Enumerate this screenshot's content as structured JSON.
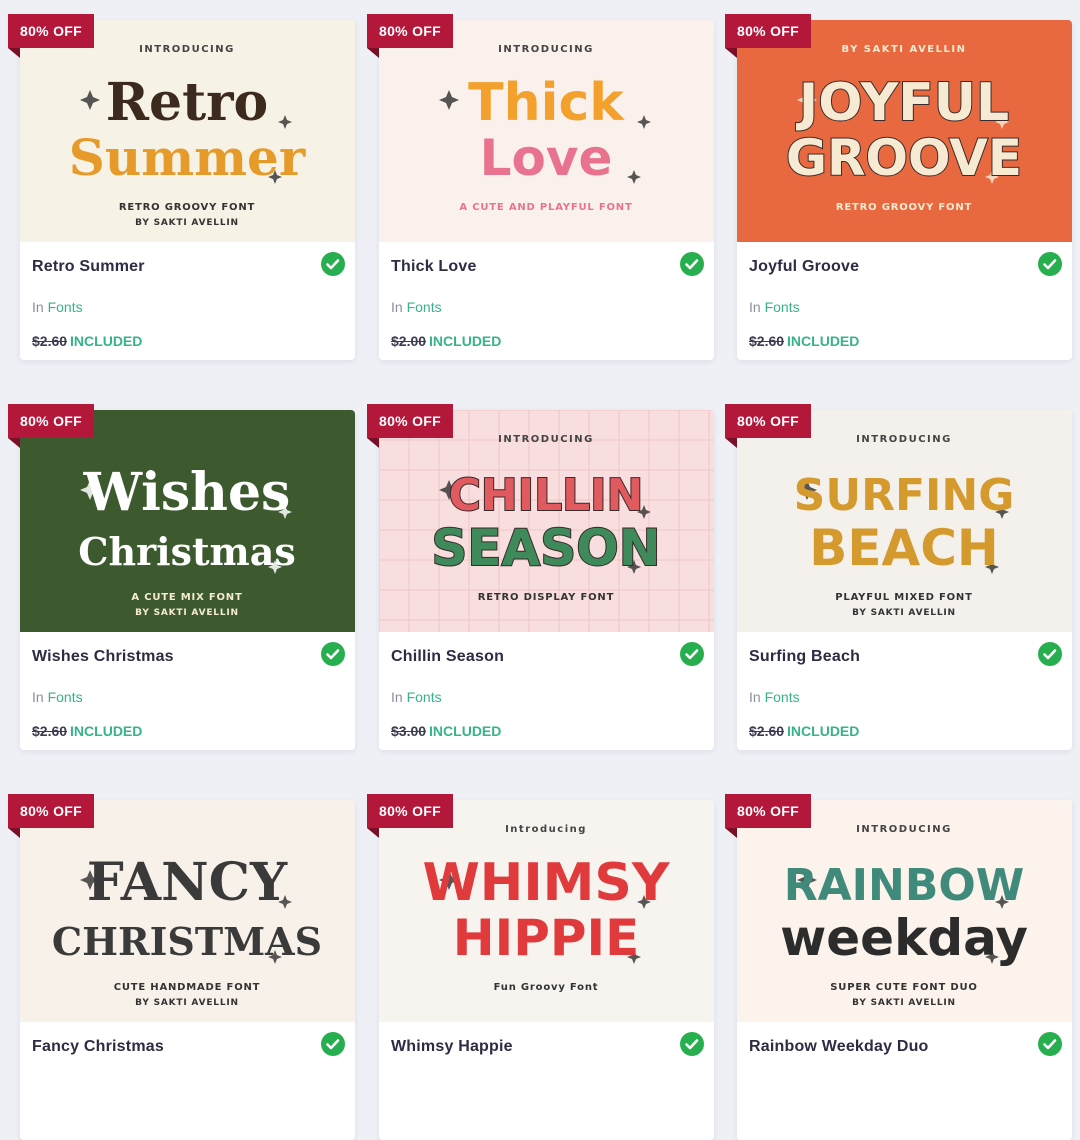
{
  "products": [
    {
      "badge": "80% OFF",
      "title": "Retro Summer",
      "category_prefix": "In",
      "category": "Fonts",
      "old_price": "$2.60",
      "status": "INCLUDED",
      "included": true,
      "thumb": {
        "bg": "#f7f2e6",
        "top_text": "INTRODUCING",
        "line1": "Retro",
        "line2": "Summer",
        "color1": "#3d2a1e",
        "color2": "#e69a2a",
        "sub1": "RETRO GROOVY FONT",
        "sub2": "BY SAKTI AVELLIN"
      }
    },
    {
      "badge": "80% OFF",
      "title": "Thick Love",
      "category_prefix": "In",
      "category": "Fonts",
      "old_price": "$2.00",
      "status": "INCLUDED",
      "included": true,
      "thumb": {
        "bg": "#fbf1ec",
        "top_text": "INTRODUCING",
        "line1": "Thick",
        "line2": "Love",
        "color1": "#f3a12c",
        "color2": "#e9738e",
        "sub1": "A CUTE AND PLAYFUL FONT",
        "sub2": ""
      }
    },
    {
      "badge": "80% OFF",
      "title": "Joyful Groove",
      "category_prefix": "In",
      "category": "Fonts",
      "old_price": "$2.60",
      "status": "INCLUDED",
      "included": true,
      "thumb": {
        "bg": "#e8693f",
        "top_text": "BY SAKTI AVELLIN",
        "line1": "JOYFUL",
        "line2": "GROOVE",
        "color1": "#f6ead2",
        "color2": "#f6ead2",
        "sub1": "RETRO GROOVY FONT",
        "sub2": ""
      }
    },
    {
      "badge": "80% OFF",
      "title": "Wishes Christmas",
      "category_prefix": "In",
      "category": "Fonts",
      "old_price": "$2.60",
      "status": "INCLUDED",
      "included": true,
      "thumb": {
        "bg": "#3d5a2f",
        "top_text": "",
        "line1": "Wishes",
        "line2": "Christmas",
        "color1": "#ffffff",
        "color2": "#ffffff",
        "sub1": "A CUTE MIX FONT",
        "sub2": "BY SAKTI AVELLIN"
      }
    },
    {
      "badge": "80% OFF",
      "title": "Chillin Season",
      "category_prefix": "In",
      "category": "Fonts",
      "old_price": "$3.00",
      "status": "INCLUDED",
      "included": true,
      "thumb": {
        "bg": "#f8dede",
        "top_text": "INTRODUCING",
        "line1": "CHILLIN",
        "line2": "SEASON",
        "color1": "#e05a5f",
        "color2": "#3f8a5a",
        "sub1": "RETRO DISPLAY FONT",
        "sub2": ""
      }
    },
    {
      "badge": "80% OFF",
      "title": "Surfing Beach",
      "category_prefix": "In",
      "category": "Fonts",
      "old_price": "$2.60",
      "status": "INCLUDED",
      "included": true,
      "thumb": {
        "bg": "#f4f1ec",
        "top_text": "INTRODUCING",
        "line1": "SURFING",
        "line2": "BEACH",
        "color1": "#d59a2e",
        "color2": "#d59a2e",
        "sub1": "PLAYFUL MIXED FONT",
        "sub2": "BY SAKTI AVELLIN"
      }
    },
    {
      "badge": "80% OFF",
      "title": "Fancy Christmas",
      "category_prefix": "",
      "category": "",
      "old_price": "",
      "status": "",
      "included": true,
      "thumb": {
        "bg": "#f8f1ea",
        "top_text": "",
        "line1": "FANCY",
        "line2": "CHRISTMAS",
        "color1": "#3a3a3a",
        "color2": "#3a3a3a",
        "sub1": "CUTE HANDMADE FONT",
        "sub2": "BY SAKTI AVELLIN"
      }
    },
    {
      "badge": "80% OFF",
      "title": "Whimsy Happie",
      "category_prefix": "",
      "category": "",
      "old_price": "",
      "status": "",
      "included": true,
      "thumb": {
        "bg": "#f7f3ee",
        "top_text": "Introducing",
        "line1": "WHIMSY",
        "line2": "HIPPIE",
        "color1": "#e03a3c",
        "color2": "#e03a3c",
        "sub1": "Fun Groovy Font",
        "sub2": ""
      }
    },
    {
      "badge": "80% OFF",
      "title": "Rainbow Weekday Duo",
      "category_prefix": "",
      "category": "",
      "old_price": "",
      "status": "",
      "included": true,
      "thumb": {
        "bg": "#fbf3ec",
        "top_text": "INTRODUCING",
        "line1": "RAINBOW",
        "line2": "weekday",
        "color1": "#3f8a7a",
        "color2": "#2c2c2c",
        "sub1": "SUPER CUTE FONT DUO",
        "sub2": "BY SAKTI AVELLIN"
      }
    }
  ],
  "colors": {
    "badge": "#b3173a",
    "check": "#27ae4f",
    "link": "#36b38a",
    "page_bg": "#eef0f6"
  },
  "icons": {
    "badge_check": "check-circle-icon"
  }
}
